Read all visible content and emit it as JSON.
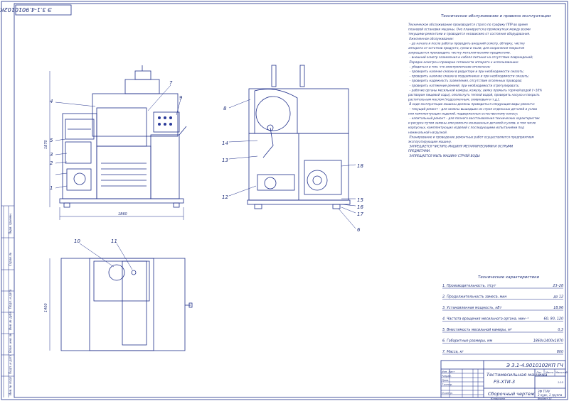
{
  "sheet": {
    "corner_code": "Э 3.1-4.9010102КП ГЧ",
    "strip": [
      "Перв. примен.",
      "Справ. №",
      "Подп. и дата",
      "Инв. № дубл.",
      "Взам. инв. №",
      "Подп. и дата",
      "Инв. № подл."
    ]
  },
  "front_view": {
    "dim_height": "1870",
    "dim_width": "1860",
    "callouts": [
      "4",
      "5",
      "3",
      "2",
      "",
      "1",
      "7",
      "9"
    ]
  },
  "side_view": {
    "callouts": [
      "8",
      "14",
      "13",
      "12",
      "18",
      "15",
      "16",
      "17",
      "6"
    ]
  },
  "top_view": {
    "dim_depth": "1400",
    "callouts": [
      "10",
      "11"
    ]
  },
  "notes": {
    "title": "Техническое обслуживание и правила эксплуатации",
    "lines": [
      "Техническое обслуживание производится строго по графику ППР во время",
      "плановой остановки машины. Оно планируется в промежутках между всеми",
      "текущими ремонтами и проводится независимо от состояния оборудования.",
      "  Ежесменное обслуживание:",
      "  – до начала и после работы проводить внешний осмотр, обтирку, чистку",
      "аппарата от остатков продукта, грязи и пыли; для сохранения покрытия",
      "запрещается производить чистку металлическими предметами.",
      "  – внешний осмотр заземления и кабеля питания на отсутствие повреждений;",
      "  Порядок осмотра и проверки готовности аппарата к использованию:",
      "  – убедиться в том, что электропитание отключено;",
      "  – проверить наличие смазки в редукторе и при необходимости смазать;",
      "  – проверить наличие смазки в подшипниках и при необходимости смазать;",
      "  – проверить надежность заземления, отсутствие оголенных проводов;",
      "  – проверить натяжение ремней, при необходимости отрегулировать;",
      "  – рабочие органы месильной камеры, кожуху, вилку промыть горячей водой (~10%",
      "раствором пищевой соды), ополоснуть теплой водой, проверить насухо и покрыть",
      "растительным маслом (подсолнечным, оливковым и т.д.).",
      "  В ходе эксплуатации машины должны проводиться следующие виды ремонта:",
      "  – текущий ремонт – для замены вышедших из строя отдельных деталей и узлов",
      "или комплектующих изделий, подверженных естественному износу;",
      "  – капитальный ремонт – для полного восстановления технических характеристик",
      "и ресурса путем замены или ремонта изношенных деталей и узлов, в том числе",
      "корпусных, комплектующих изделий с последующими испытаниями под",
      "номинальной нагрузкой.",
      "  Планирование и проведение ремонтных работ осуществляется предприятием",
      "эксплуатирующим машину.",
      "  ЗАПРЕЩАЕТСЯ ЧИСТИТЬ МАШИНУ МЕТАЛЛИЧЕСКИМИ И ОСТРЫМИ",
      "ПРЕДМЕТАМИ.",
      "  ЗАПРЕЩАЕТСЯ МЫТЬ МАШИНУ СТРУЕЙ ВОДЫ"
    ]
  },
  "specs": {
    "title": "Технические характеристики",
    "rows": [
      {
        "label": "1. Производительность, т/сут",
        "value": "23–28"
      },
      {
        "label": "2. Продолжительность замеса, мин",
        "value": "до 12"
      },
      {
        "label": "3. Установленная мощность, кВт",
        "value": "18,96"
      },
      {
        "label": "4. Частота вращения месильного органа, мин⁻¹",
        "value": "60, 90, 120"
      },
      {
        "label": "5. Вместимость месильной камеры, м³",
        "value": "0,3"
      },
      {
        "label": "6. Габаритные размеры, мм",
        "value": "1860х1400х1870"
      },
      {
        "label": "7. Масса, кг",
        "value": "800"
      }
    ]
  },
  "title_block": {
    "doc_number": "Э 3.1-4.9010102КП ГЧ",
    "product_name": "Тестомесильная машина",
    "product_code": "Р3-ХТИ-3",
    "drawing_type": "Сборочный чертеж",
    "lit_label": "Лит.",
    "mass_label": "Масса",
    "scale_label": "Масштаб",
    "scale": "1:10",
    "org": "ЗФ ТГАУ",
    "group": "3 курс, 1 группа",
    "roles": [
      "Изм. Лист",
      "Разраб.",
      "Пров.",
      "Т.контр.",
      "Н.контр."
    ],
    "copied": "Копировал",
    "format": "Формат  А1"
  }
}
